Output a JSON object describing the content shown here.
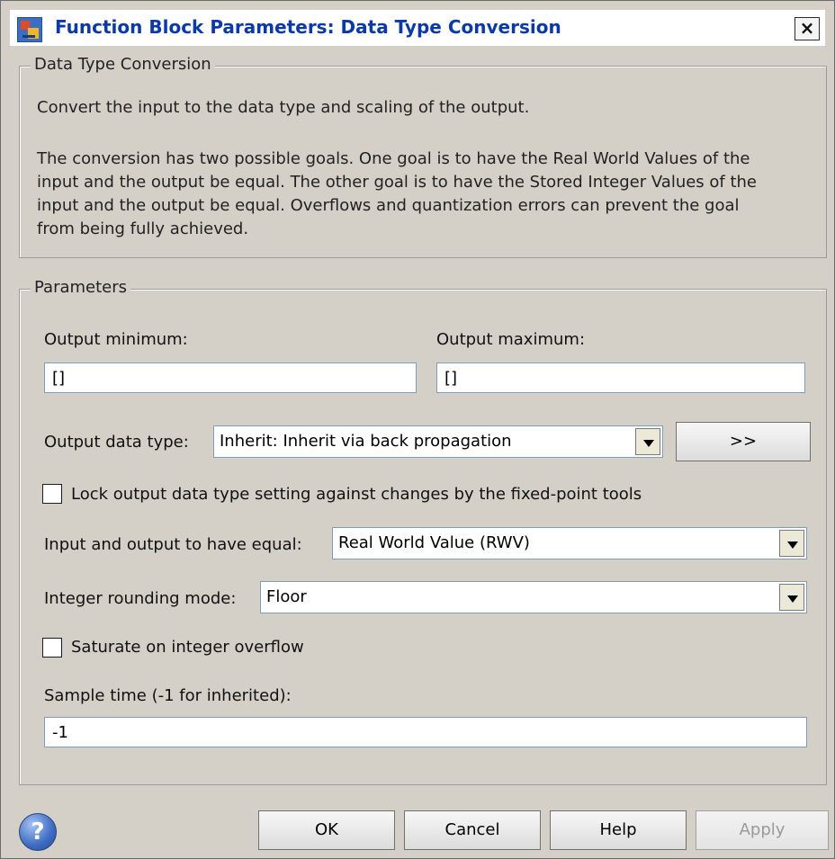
{
  "window": {
    "title": "Function Block Parameters: Data Type Conversion",
    "close_glyph": "×"
  },
  "description_group": {
    "legend": "Data Type Conversion",
    "line1": "Convert the input to the data type and scaling of the output.",
    "para": [
      "The conversion has two possible goals. One goal is to have the Real World Values of the",
      "input and the output be equal.  The other goal is to have the Stored Integer Values of the",
      "input and the output be equal.  Overflows and quantization errors can prevent the goal",
      "from being fully achieved."
    ]
  },
  "parameters": {
    "legend": "Parameters",
    "output_min_label": "Output minimum:",
    "output_min_value": "[]",
    "output_max_label": "Output maximum:",
    "output_max_value": "[]",
    "output_data_type_label": "Output data type:",
    "output_data_type_value": "Inherit: Inherit via back propagation",
    "dt_assistant_label": ">>",
    "lock_label": "Lock output data type setting against changes by the fixed-point tools",
    "lock_checked": false,
    "equal_label": "Input and output to have equal:",
    "equal_value": "Real World Value (RWV)",
    "rounding_label": "Integer rounding mode:",
    "rounding_value": "Floor",
    "saturate_label": "Saturate on integer overflow",
    "saturate_checked": false,
    "sample_time_label": "Sample time (-1 for inherited):",
    "sample_time_value": "-1"
  },
  "buttons": {
    "help_icon": "?",
    "ok": "OK",
    "cancel": "Cancel",
    "help": "Help",
    "apply": "Apply"
  }
}
